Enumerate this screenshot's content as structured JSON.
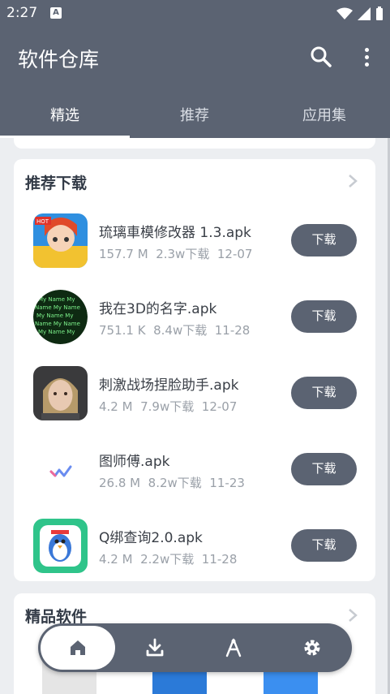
{
  "status_bar": {
    "time": "2:27",
    "notification_icon": "A"
  },
  "app_bar": {
    "title": "软件仓库",
    "search_icon": "search-icon",
    "menu_icon": "more-vert-icon"
  },
  "tabs": [
    {
      "label": "精选",
      "active": true
    },
    {
      "label": "推荐",
      "active": false
    },
    {
      "label": "应用集",
      "active": false
    }
  ],
  "recommended": {
    "title": "推荐下载",
    "apps": [
      {
        "name": "琉璃車模修改器 1.3.apk",
        "size": "157.7 M",
        "downloads": "2.3w下载",
        "date": "12-07",
        "button": "下载"
      },
      {
        "name": "我在3D的名字.apk",
        "size": "751.1 K",
        "downloads": "8.4w下载",
        "date": "11-28",
        "button": "下载"
      },
      {
        "name": "刺激战场捏脸助手.apk",
        "size": "4.2 M",
        "downloads": "7.9w下载",
        "date": "12-07",
        "button": "下载"
      },
      {
        "name": "图师傅.apk",
        "size": "26.8 M",
        "downloads": "8.2w下载",
        "date": "11-23",
        "button": "下载"
      },
      {
        "name": "Q绑查询2.0.apk",
        "size": "4.2 M",
        "downloads": "2.2w下载",
        "date": "11-28",
        "button": "下载"
      }
    ]
  },
  "featured": {
    "title": "精品软件"
  },
  "bottom_nav": [
    {
      "icon": "home-icon",
      "active": true
    },
    {
      "icon": "download-icon",
      "active": false
    },
    {
      "icon": "compass-icon",
      "active": false
    },
    {
      "icon": "settings-icon",
      "active": false
    }
  ],
  "colors": {
    "primary": "#5b6372",
    "background": "#eceef1",
    "card": "#ffffff"
  }
}
